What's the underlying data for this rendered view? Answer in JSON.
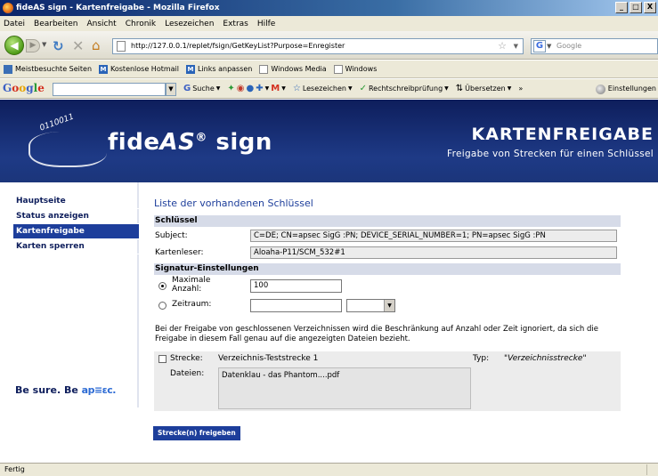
{
  "window": {
    "title": "fideAS sign - Kartenfreigabe - Mozilla Firefox",
    "controls": [
      "_",
      "□",
      "X"
    ]
  },
  "menu": [
    "Datei",
    "Bearbeiten",
    "Ansicht",
    "Chronik",
    "Lesezeichen",
    "Extras",
    "Hilfe"
  ],
  "navigation": {
    "url": "http://127.0.0.1/replet/fsign/GetKeyList?Purpose=Enregister",
    "search_placeholder": "Google"
  },
  "bookmarks": [
    {
      "label": "Meistbesuchte Seiten",
      "icon": "rss-icon"
    },
    {
      "label": "Kostenlose Hotmail",
      "icon": "hotmail-icon"
    },
    {
      "label": "Links anpassen",
      "icon": "hotmail-icon"
    },
    {
      "label": "Windows Media",
      "icon": "page-icon"
    },
    {
      "label": "Windows",
      "icon": "page-icon"
    }
  ],
  "google_toolbar": {
    "logo": "Google",
    "search_label": "Suche",
    "bookmarks_label": "Lesezeichen",
    "spellcheck_label": "Rechtschreibprüfung",
    "translate_label": "Übersetzen",
    "more_label": "»",
    "settings_label": "Einstellungen"
  },
  "banner": {
    "logo_digits": "0110011",
    "brand_prefix": "fide",
    "brand_italic": "AS",
    "brand_reg": "®",
    "brand_suffix": "sign",
    "title": "KARTENFREIGABE",
    "subtitle": "Freigabe von Strecken für einen Schlüssel"
  },
  "sidebar": {
    "items": [
      {
        "label": "Hauptseite",
        "active": false
      },
      {
        "label": "Status anzeigen",
        "active": false
      },
      {
        "label": "Kartenfreigabe",
        "active": true
      },
      {
        "label": "Karten sperren",
        "active": false
      }
    ],
    "tagline_prefix": "Be sure. Be",
    "tagline_brand": "ap≡εc."
  },
  "main": {
    "heading": "Liste der vorhandenen Schlüssel",
    "key_section": "Schlüssel",
    "subject_label": "Subject:",
    "subject_value": "C=DE; CN=apsec SigG :PN; DEVICE_SERIAL_NUMBER=1; PN=apsec SigG :PN",
    "reader_label": "Kartenleser:",
    "reader_value": "Aloaha-P11/SCM_532#1",
    "signature_section": "Signatur-Einstellungen",
    "max_count_label": "Maximale Anzahl:",
    "max_count_value": "100",
    "max_count_selected": true,
    "period_label": "Zeitraum:",
    "period_value": "",
    "period_unit": "",
    "note": "Bei der Freigabe von geschlossenen Verzeichnissen wird die Beschränkung auf Anzahl oder Zeit ignoriert, da sich die Freigabe in diesem Fall genau auf die angezeigten Dateien bezieht.",
    "stretch": {
      "label": "Strecke:",
      "name": "Verzeichnis-Teststrecke 1",
      "type_label": "Typ:",
      "type_value": "\"Verzeichnisstrecke\"",
      "files_label": "Dateien:",
      "files_value": "Datenklau - das Phantom....pdf",
      "checked": false
    },
    "release_button": "Strecke(n) freigeben"
  },
  "status": "Fertig",
  "colors": {
    "banner": "#1e3a86",
    "accent": "#1d3e9b",
    "section_header": "#d6dbe8"
  }
}
